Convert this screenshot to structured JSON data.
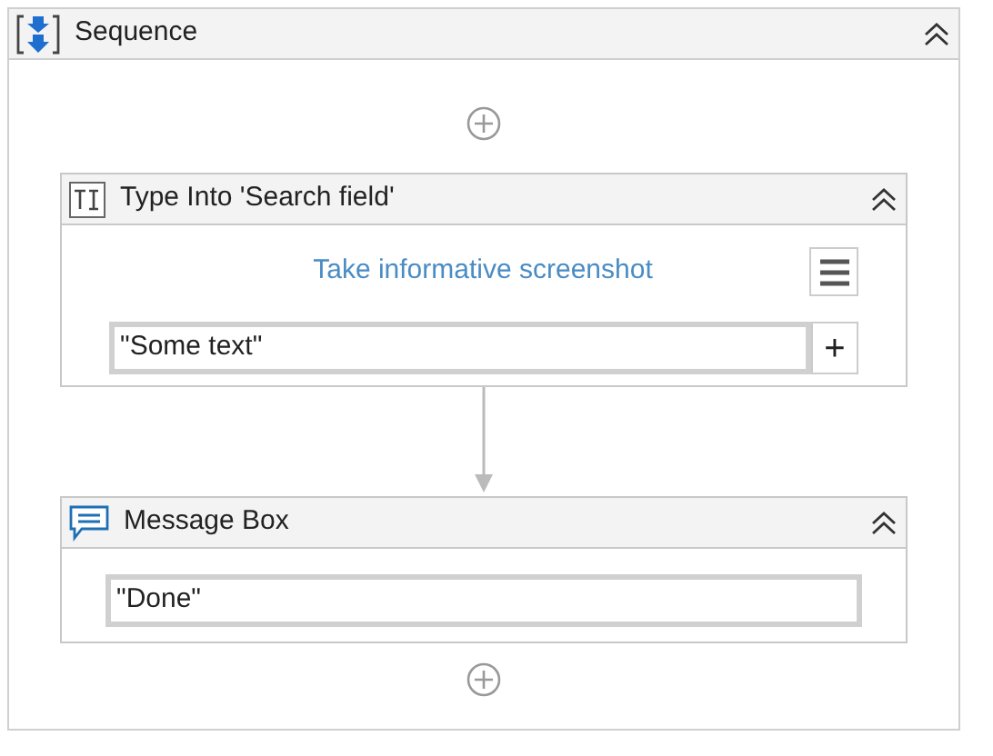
{
  "sequence": {
    "title": "Sequence",
    "expanded": true
  },
  "activities": [
    {
      "kind": "type_into",
      "title": "Type Into 'Search field'",
      "expanded": true,
      "link": "Take informative screenshot",
      "value": "\"Some text\"",
      "plus": "+"
    },
    {
      "kind": "message_box",
      "title": "Message Box",
      "expanded": true,
      "value": "\"Done\""
    }
  ]
}
